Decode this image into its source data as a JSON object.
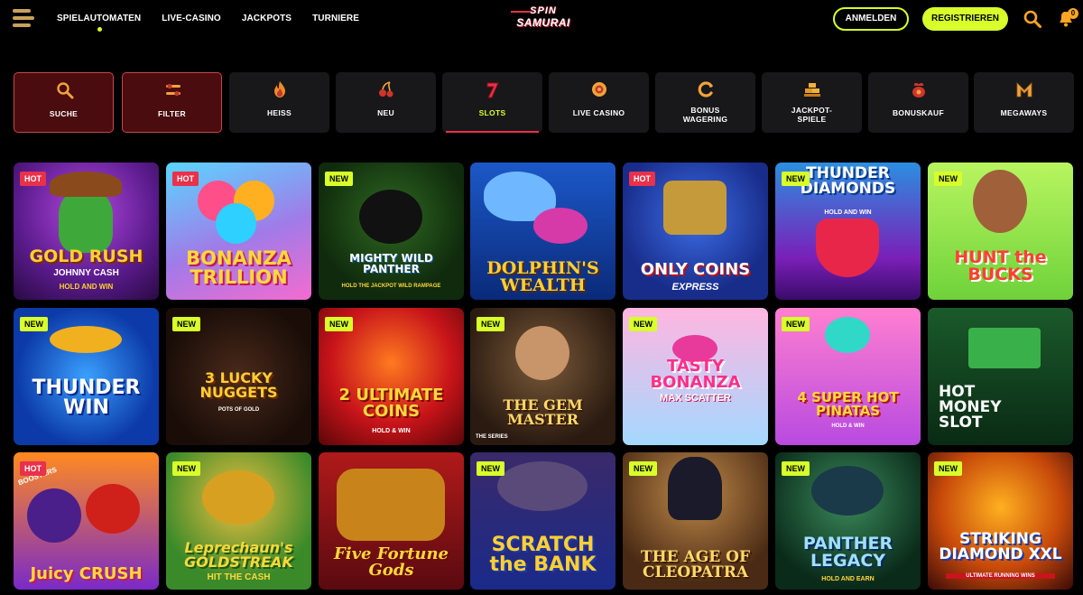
{
  "header": {
    "nav": [
      "SPIELAUTOMATEN",
      "LIVE-CASINO",
      "JACKPOTS",
      "TURNIERE"
    ],
    "logo": {
      "line1": "SPIN",
      "line2": "SAMURAI"
    },
    "login_label": "ANMELDEN",
    "register_label": "REGISTRIEREN",
    "notification_count": "0"
  },
  "categories": [
    {
      "label": "SUCHE",
      "icon": "magnifier-icon"
    },
    {
      "label": "FILTER",
      "icon": "filter-icon"
    },
    {
      "label": "HEISS",
      "icon": "flame-icon"
    },
    {
      "label": "NEU",
      "icon": "slot-cherries-icon"
    },
    {
      "label": "SLOTS",
      "icon": "seven-icon"
    },
    {
      "label": "LIVE CASINO",
      "icon": "chip-icon"
    },
    {
      "label": "BONUS\nWAGERING",
      "icon": "wagering-icon"
    },
    {
      "label": "JACKPOT-\nSPIELE",
      "icon": "gold-bars-icon"
    },
    {
      "label": "BONUSKAUF",
      "icon": "bonus-bag-icon"
    },
    {
      "label": "MEGAWAYS",
      "icon": "megaways-icon"
    }
  ],
  "games": [
    {
      "title": "GOLD RUSH",
      "subtitle": "JOHNNY CASH",
      "extra": "HOLD AND WIN",
      "badge": "HOT"
    },
    {
      "title": "BONANZA TRILLION",
      "subtitle": "",
      "extra": "",
      "badge": "HOT"
    },
    {
      "title": "MIGHTY WILD PANTHER",
      "subtitle": "HOLD THE JACKPOT WILD RAMPAGE",
      "extra": "",
      "badge": "NEW"
    },
    {
      "title": "DOLPHIN'S WEALTH",
      "subtitle": "",
      "extra": "",
      "badge": ""
    },
    {
      "title": "ONLY COINS",
      "subtitle": "EXPRESS",
      "extra": "",
      "badge": "HOT"
    },
    {
      "title": "THUNDER DIAMONDS",
      "subtitle": "HOLD AND WIN",
      "extra": "",
      "badge": "NEW"
    },
    {
      "title": "HUNT the BUCKS",
      "subtitle": "",
      "extra": "",
      "badge": "NEW"
    },
    {
      "title": "THUNDER WIN",
      "subtitle": "",
      "extra": "",
      "badge": "NEW"
    },
    {
      "title": "3 LUCKY NUGGETS",
      "subtitle": "POTS OF GOLD",
      "extra": "",
      "badge": "NEW"
    },
    {
      "title": "2 ULTIMATE COINS",
      "subtitle": "HOLD & WIN",
      "extra": "",
      "badge": "NEW"
    },
    {
      "title": "THE GEM MASTER",
      "subtitle": "THE SERIES",
      "extra": "",
      "badge": "NEW"
    },
    {
      "title": "TASTY BONANZA",
      "subtitle": "MAX SCATTER",
      "extra": "",
      "badge": "NEW"
    },
    {
      "title": "4 SUPER HOT PINATAS",
      "subtitle": "HOLD & WIN",
      "extra": "",
      "badge": "NEW"
    },
    {
      "title": "HOT MONEY SLOT",
      "subtitle": "",
      "extra": "",
      "badge": ""
    },
    {
      "title": "Juicy CRUSH",
      "subtitle": "BOOSTERS",
      "extra": "",
      "badge": "HOT"
    },
    {
      "title": "Leprechaun's GOLDSTREAK",
      "subtitle": "HIT THE CASH",
      "extra": "",
      "badge": "NEW"
    },
    {
      "title": "Five Fortune Gods",
      "subtitle": "",
      "extra": "",
      "badge": ""
    },
    {
      "title": "SCRATCH the BANK",
      "subtitle": "",
      "extra": "",
      "badge": "NEW"
    },
    {
      "title": "THE AGE OF CLEOPATRA",
      "subtitle": "",
      "extra": "",
      "badge": "NEW"
    },
    {
      "title": "PANTHER LEGACY",
      "subtitle": "HOLD AND EARN",
      "extra": "",
      "badge": "NEW"
    },
    {
      "title": "STRIKING DIAMOND XXL",
      "subtitle": "ULTIMATE RUNNING WINS",
      "extra": "",
      "badge": "NEW"
    }
  ],
  "colors": {
    "accent": "#d8ff2a",
    "hot": "#e8314a",
    "category_bg": "#18181a",
    "category_active_bg": "#4a0c0e"
  }
}
